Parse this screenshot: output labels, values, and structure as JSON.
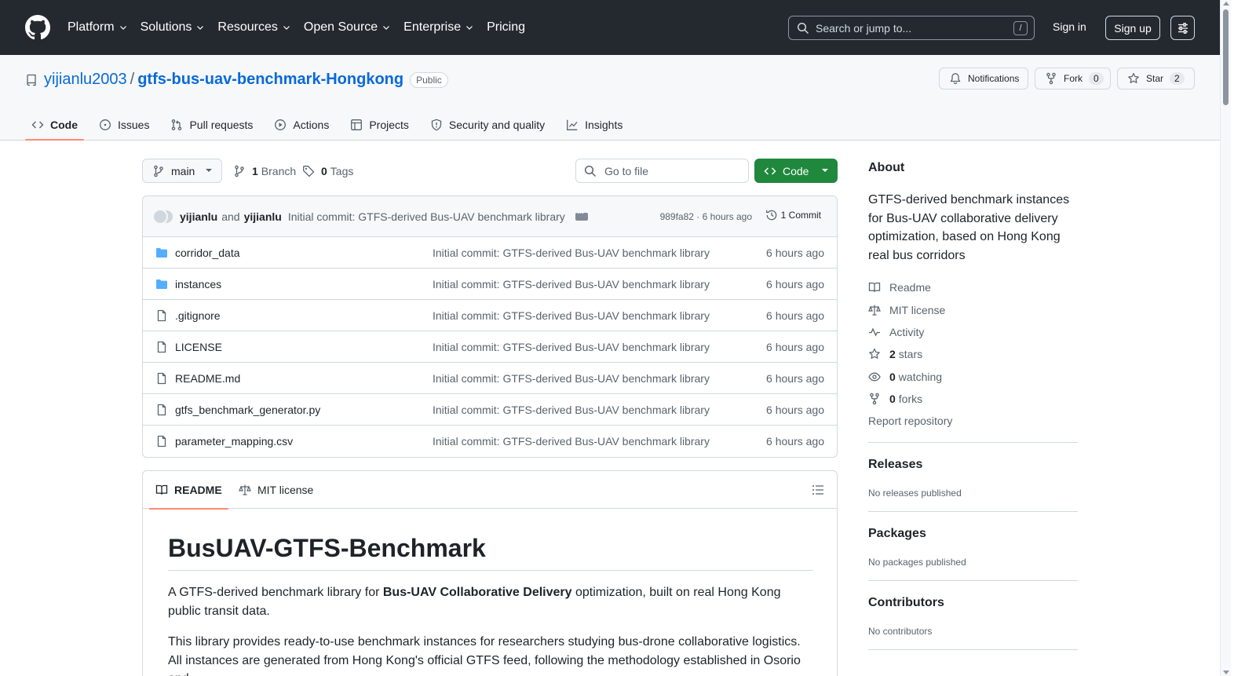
{
  "header": {
    "nav": [
      {
        "label": "Platform",
        "dropdown": true
      },
      {
        "label": "Solutions",
        "dropdown": true
      },
      {
        "label": "Resources",
        "dropdown": true
      },
      {
        "label": "Open Source",
        "dropdown": true
      },
      {
        "label": "Enterprise",
        "dropdown": true
      },
      {
        "label": "Pricing",
        "dropdown": false
      }
    ],
    "search_placeholder": "Search or jump to...",
    "search_shortcut": "/",
    "sign_in": "Sign in",
    "sign_up": "Sign up"
  },
  "repo": {
    "owner": "yijianlu2003",
    "separator": "/",
    "name": "gtfs-bus-uav-benchmark-Hongkong",
    "visibility": "Public",
    "notifications_label": "Notifications",
    "fork_label": "Fork",
    "fork_count": "0",
    "star_label": "Star",
    "star_count": "2"
  },
  "tabs": [
    {
      "label": "Code",
      "icon": "code-icon",
      "active": true
    },
    {
      "label": "Issues",
      "icon": "issue-icon"
    },
    {
      "label": "Pull requests",
      "icon": "pull-request-icon"
    },
    {
      "label": "Actions",
      "icon": "play-icon"
    },
    {
      "label": "Projects",
      "icon": "table-icon"
    },
    {
      "label": "Security and quality",
      "icon": "shield-icon"
    },
    {
      "label": "Insights",
      "icon": "graph-icon"
    }
  ],
  "filenav": {
    "branch": "main",
    "branch_count": "1",
    "branch_label": "Branch",
    "tag_count": "0",
    "tag_label": "Tags",
    "goto_placeholder": "Go to file",
    "code_button": "Code"
  },
  "commit": {
    "author1": "yijianlu",
    "and": "and",
    "author2": "yijianlu",
    "message": "Initial commit: GTFS-derived Bus-UAV benchmark library",
    "meta": "989fa82 · 6 hours ago",
    "commits_link": "1 Commit"
  },
  "files": [
    {
      "name": "corridor_data",
      "type": "folder",
      "message": "Initial commit: GTFS-derived Bus-UAV benchmark library",
      "age": "6 hours ago"
    },
    {
      "name": "instances",
      "type": "folder",
      "message": "Initial commit: GTFS-derived Bus-UAV benchmark library",
      "age": "6 hours ago"
    },
    {
      "name": ".gitignore",
      "type": "file",
      "message": "Initial commit: GTFS-derived Bus-UAV benchmark library",
      "age": "6 hours ago"
    },
    {
      "name": "LICENSE",
      "type": "file",
      "message": "Initial commit: GTFS-derived Bus-UAV benchmark library",
      "age": "6 hours ago"
    },
    {
      "name": "README.md",
      "type": "file",
      "message": "Initial commit: GTFS-derived Bus-UAV benchmark library",
      "age": "6 hours ago"
    },
    {
      "name": "gtfs_benchmark_generator.py",
      "type": "file",
      "message": "Initial commit: GTFS-derived Bus-UAV benchmark library",
      "age": "6 hours ago"
    },
    {
      "name": "parameter_mapping.csv",
      "type": "file",
      "message": "Initial commit: GTFS-derived Bus-UAV benchmark library",
      "age": "6 hours ago"
    }
  ],
  "readme": {
    "tab_readme": "README",
    "tab_license": "MIT license",
    "title": "BusUAV-GTFS-Benchmark",
    "p1_before": "A GTFS-derived benchmark library for ",
    "p1_bold": "Bus-UAV Collaborative Delivery",
    "p1_after": " optimization, built on real Hong Kong public transit data.",
    "p2": "This library provides ready-to-use benchmark instances for researchers studying bus-drone collaborative logistics. All instances are generated from Hong Kong's official GTFS feed, following the methodology established in Osorio and"
  },
  "about": {
    "heading": "About",
    "description": "GTFS-derived benchmark instances for Bus-UAV collaborative delivery optimization, based on Hong Kong real bus corridors",
    "readme": "Readme",
    "license": "MIT license",
    "activity": "Activity",
    "stars_count": "2",
    "stars_label": "stars",
    "watching_count": "0",
    "watching_label": "watching",
    "forks_count": "0",
    "forks_label": "forks",
    "report": "Report repository"
  },
  "releases": {
    "heading": "Releases",
    "empty": "No releases published"
  },
  "packages": {
    "heading": "Packages",
    "empty": "No packages published"
  },
  "contributors": {
    "heading": "Contributors",
    "empty": "No contributors"
  },
  "colors": {
    "header_bg": "#24292f",
    "link": "#0969da",
    "primary_button": "#1f883d",
    "active_tab_underline": "#fd8c73",
    "folder": "#54aeff"
  }
}
